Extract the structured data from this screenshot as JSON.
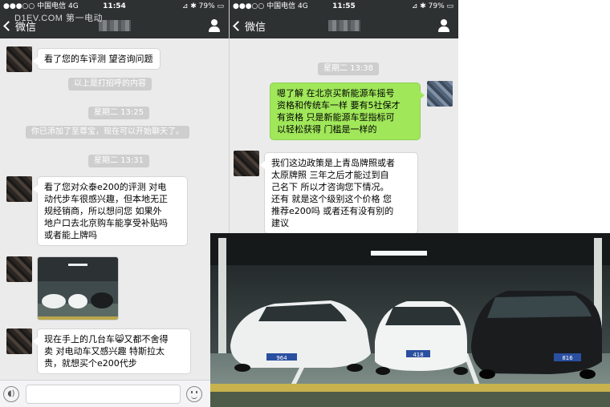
{
  "watermark": "D1EV.COM 第一电动",
  "left": {
    "status": {
      "signal": "●●●○○ 中国电信  4G",
      "time": "11:54",
      "battery": "⊿ ✱ 79% ▭"
    },
    "nav": {
      "back_label": "微信"
    },
    "messages": [
      {
        "kind": "in",
        "text": "看了您的车评测 望咨询问题"
      },
      {
        "kind": "system",
        "text": "以上是打招呼的内容"
      },
      {
        "kind": "time",
        "text": "星期二 13:25"
      },
      {
        "kind": "system",
        "text": "你已添加了至尊宝，现在可以开始聊天了。"
      },
      {
        "kind": "time",
        "text": "星期二 13:31"
      },
      {
        "kind": "in",
        "lines": [
          "看了您对众泰e200的评测 对电",
          "动代步车很感兴趣，但本地无正",
          "规经销商，所以想问您 如果外",
          "地户口去北京购车能享受补贴吗",
          "或者能上牌吗"
        ]
      },
      {
        "kind": "photo"
      },
      {
        "kind": "in",
        "lines": [
          "现在手上的几台车😸又都不舍得",
          "卖 对电动车又感兴趣 特斯拉太",
          "贵，就想买个e200代步"
        ]
      }
    ]
  },
  "right": {
    "status": {
      "signal": "●●●○○ 中国电信  4G",
      "time": "11:55",
      "battery": "⊿ ✱ 79% ▭"
    },
    "nav": {
      "back_label": "微信"
    },
    "messages": [
      {
        "kind": "time",
        "text": "星期二 13:38"
      },
      {
        "kind": "out",
        "lines": [
          "嗯了解 在北京买新能源车摇号",
          "资格和传统车一样 要有5社保才",
          "有资格 只是新能源车型指标可",
          "以轻松获得 门槛是一样的"
        ]
      },
      {
        "kind": "in",
        "lines": [
          "我们这边政策是上青岛牌照或者",
          "太原牌照 三年之后才能过到自",
          "己名下 所以才咨询您下情况。",
          "还有 就是这个级别这个价格 您",
          "推荐e200吗 或者还有没有别的",
          "建议"
        ]
      }
    ]
  },
  "photo": {
    "cars": [
      {
        "name": "white-porsche-panamera",
        "plate": "964",
        "color": "#eef0f0"
      },
      {
        "name": "white-bmw-3-series",
        "plate": "418",
        "color": "#f2f3f3"
      },
      {
        "name": "black-range-rover-evoque",
        "plate": "816",
        "color": "#1a1c1e"
      }
    ]
  }
}
